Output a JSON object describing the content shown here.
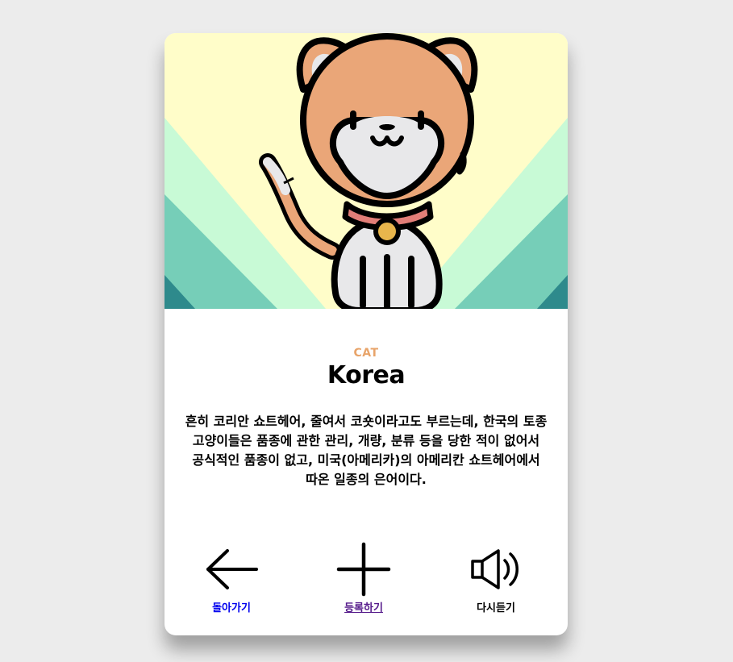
{
  "card": {
    "category": "CAT",
    "name": "Korea",
    "description": "흔히 코리안 쇼트헤어, 줄여서 코숏이라고도 부르는데, 한국의 토종 고양이들은 품종에 관한 관리, 개량, 분류 등을 당한 적이 없어서 공식적인 품종이 없고, 미국(아메리카)의 아메리칸 쇼트헤어에서 따온 일종의 은어이다."
  },
  "actions": {
    "back_label": "돌아가기",
    "add_label": "등록하기",
    "replay_label": "다시듣기"
  },
  "icons": {
    "back": "arrow-left-icon",
    "add": "plus-icon",
    "replay": "speaker-icon",
    "hero": "cat-illustration"
  },
  "colors": {
    "category_accent": "#e8a46a",
    "bg_yellow": "#fffdc9",
    "bg_mint": "#c8fad6",
    "bg_teal": "#76ceb8",
    "bg_dark_teal": "#2e8a8c",
    "cat_orange": "#eaa678",
    "cat_belly": "#e8e8ea",
    "collar": "#e27e78",
    "bell": "#e8b64c"
  }
}
